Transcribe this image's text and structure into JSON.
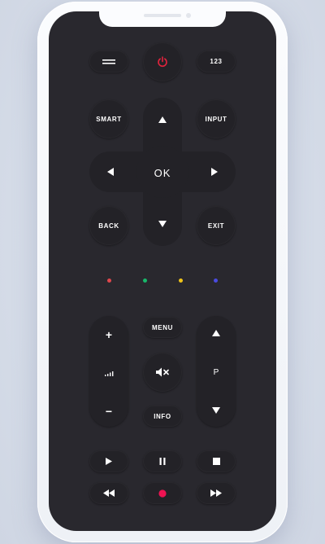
{
  "remote": {
    "top_row": {
      "number_label": "123"
    },
    "nav": {
      "smart_label": "SMART",
      "input_label": "INPUT",
      "ok_label": "OK",
      "back_label": "BACK",
      "exit_label": "EXIT"
    },
    "color_keys": [
      {
        "name": "red",
        "color": "#e0474c"
      },
      {
        "name": "green",
        "color": "#18b86a"
      },
      {
        "name": "yellow",
        "color": "#f0c419"
      },
      {
        "name": "blue",
        "color": "#4a4be0"
      }
    ],
    "middle": {
      "menu_label": "MENU",
      "info_label": "INFO",
      "volume_up": "+",
      "volume_down": "−",
      "channel_label": "P"
    },
    "colors": {
      "power": "#e2233d",
      "record": "#ee1352",
      "body": "#29282e",
      "button": "#232227"
    }
  }
}
